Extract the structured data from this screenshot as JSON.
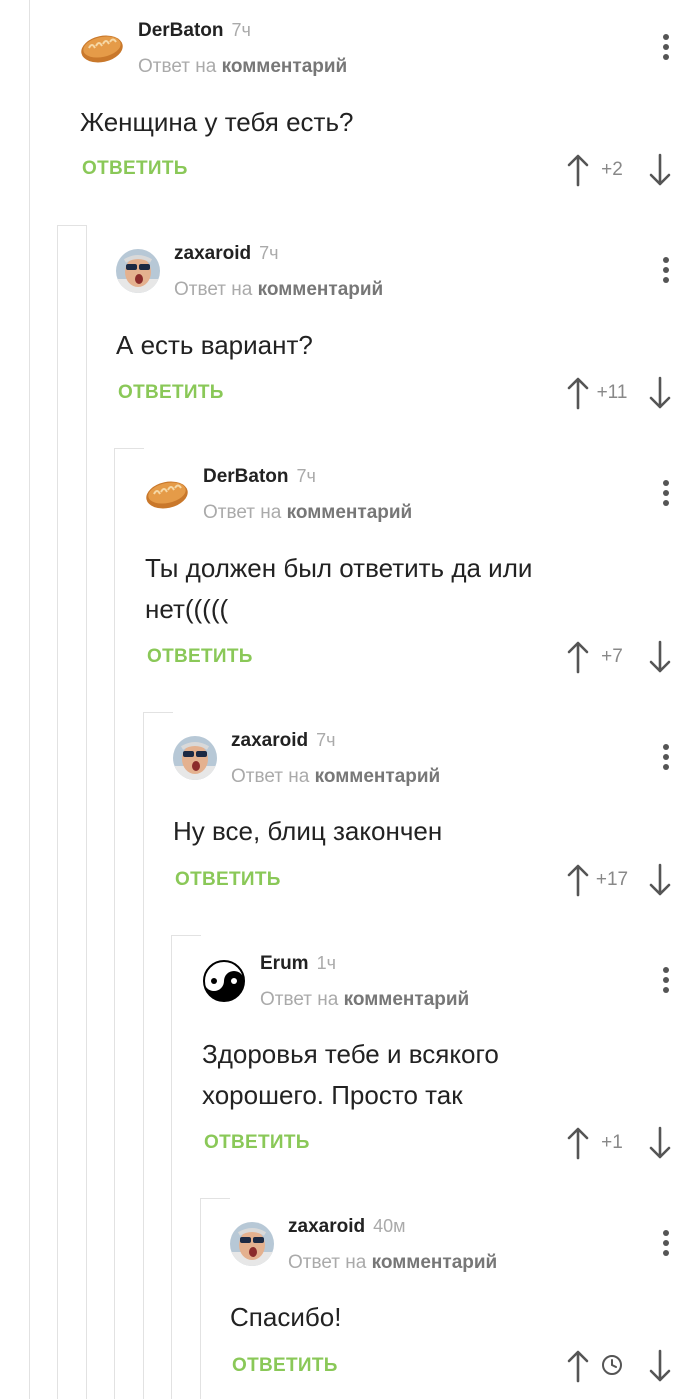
{
  "comments": [
    {
      "author": "DerBaton",
      "time": "7ч",
      "reply_prefix": "Ответ на",
      "reply_link": "комментарий",
      "text": "Женщина у тебя есть?",
      "reply_label": "ОТВЕТИТЬ",
      "rating": "+2",
      "avatar": "bread-avatar"
    },
    {
      "author": "zaxaroid",
      "time": "7ч",
      "reply_prefix": "Ответ на",
      "reply_link": "комментарий",
      "text": "А есть вариант?",
      "reply_label": "ОТВЕТИТЬ",
      "rating": "+11",
      "avatar": "man-sunglasses-avatar"
    },
    {
      "author": "DerBaton",
      "time": "7ч",
      "reply_prefix": "Ответ на",
      "reply_link": "комментарий",
      "text": "Ты должен был ответить да или нет(((((",
      "reply_label": "ОТВЕТИТЬ",
      "rating": "+7",
      "avatar": "bread-avatar"
    },
    {
      "author": "zaxaroid",
      "time": "7ч",
      "reply_prefix": "Ответ на",
      "reply_link": "комментарий",
      "text": "Ну все, блиц закончен",
      "reply_label": "ОТВЕТИТЬ",
      "rating": "+17",
      "avatar": "man-sunglasses-avatar"
    },
    {
      "author": "Erum",
      "time": "1ч",
      "reply_prefix": "Ответ на",
      "reply_link": "комментарий",
      "text": "Здоровья тебе и всякого хорошего. Просто так",
      "reply_label": "ОТВЕТИТЬ",
      "rating": "+1",
      "avatar": "yin-yang-avatar"
    },
    {
      "author": "zaxaroid",
      "time": "40м",
      "reply_prefix": "Ответ на",
      "reply_link": "комментарий",
      "text": "Спасибо!",
      "reply_label": "ОТВЕТИТЬ",
      "rating": "",
      "avatar": "man-sunglasses-avatar",
      "rating_icon": "clock-icon"
    }
  ],
  "colors": {
    "accent": "#8ac858",
    "text": "#222222",
    "muted": "#aaaaaa",
    "line": "#e2e2e2"
  }
}
